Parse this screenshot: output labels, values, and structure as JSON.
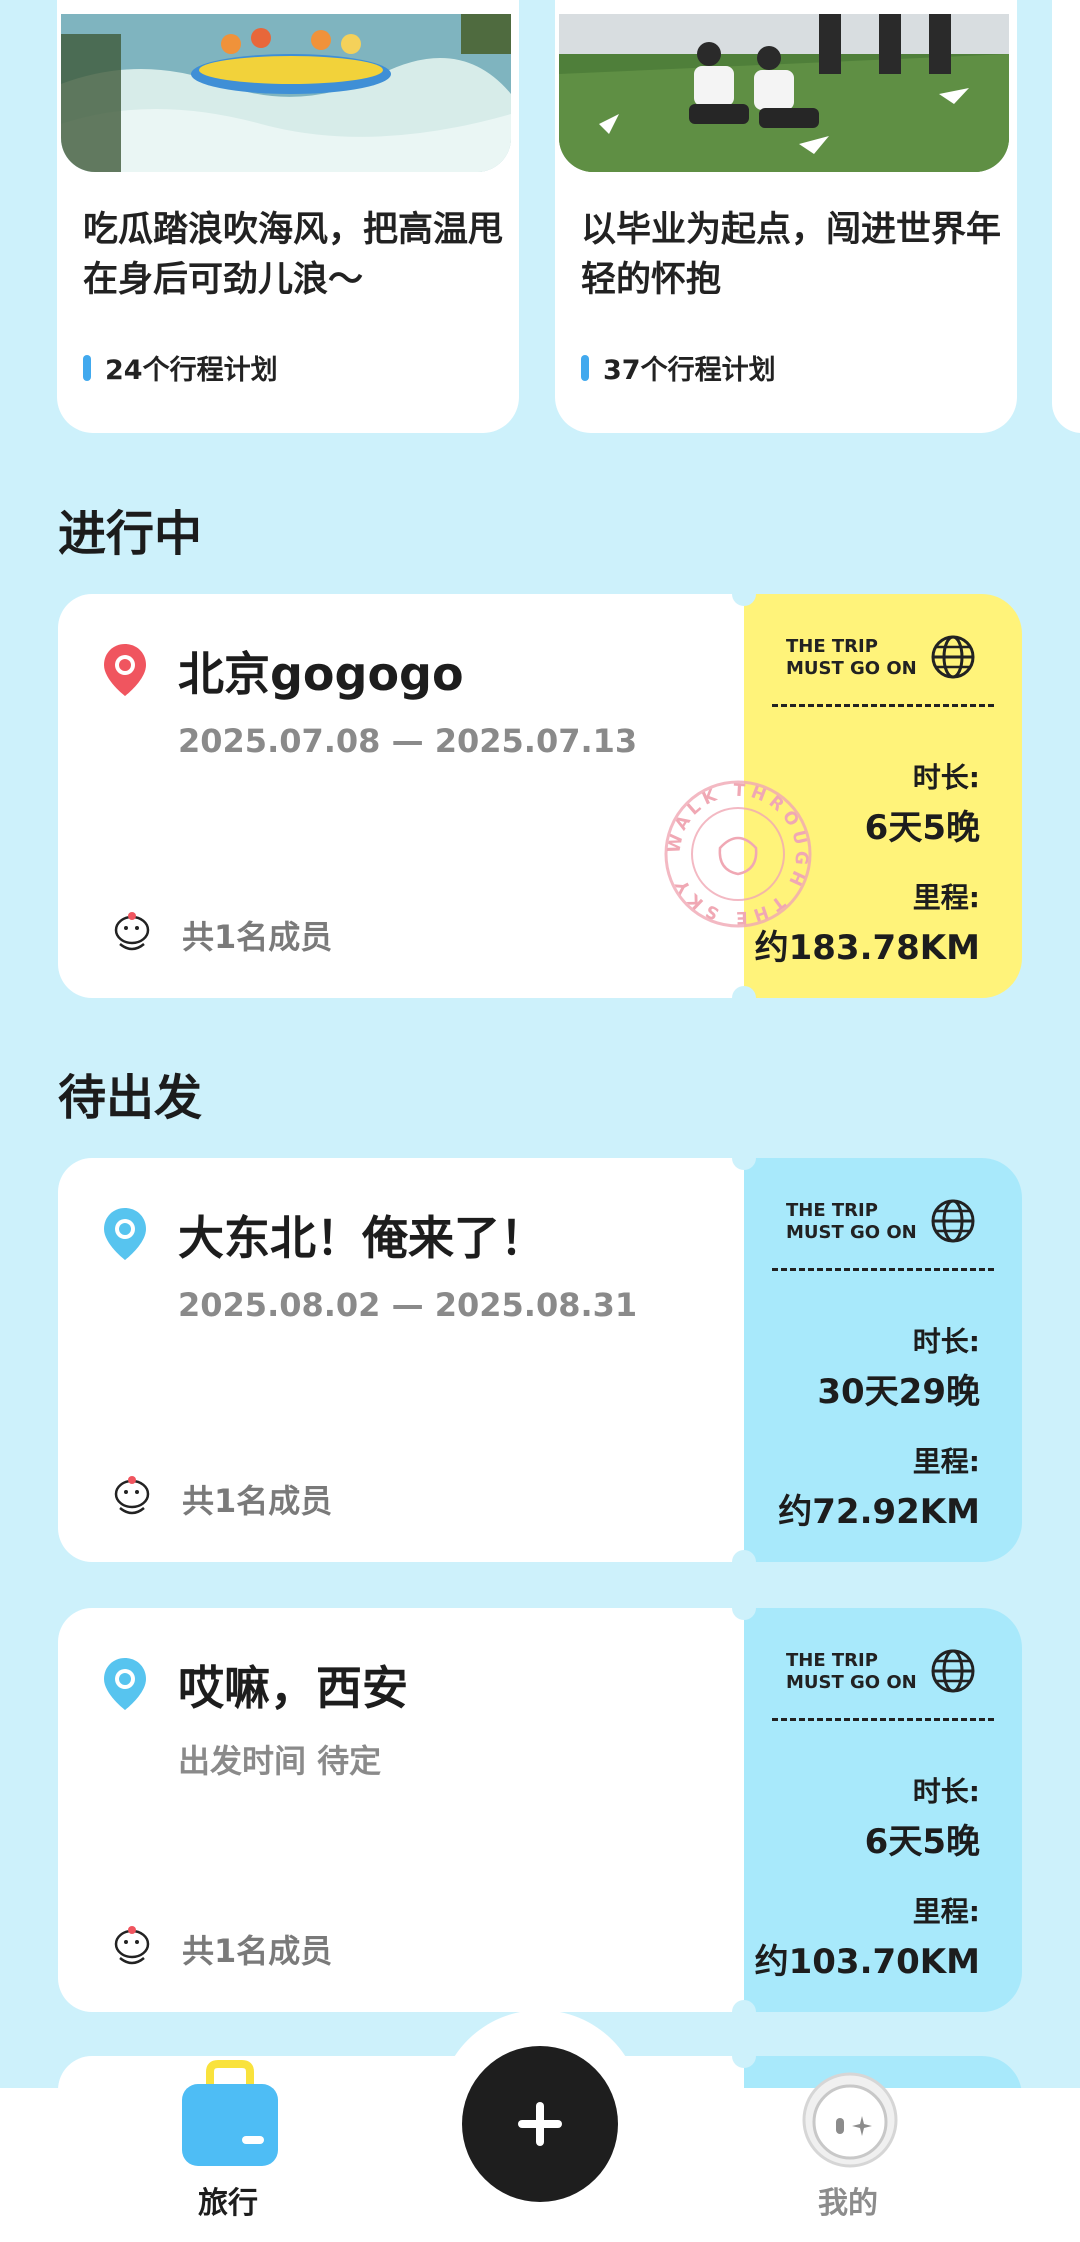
{
  "themes": [
    {
      "title": "吃瓜踏浪吹海风，把高温甩在身后可劲儿浪～",
      "count": "24个行程计划"
    },
    {
      "title": "以毕业为起点，闯进世界年轻的怀抱",
      "count": "37个行程计划"
    }
  ],
  "sections": {
    "ongoing": "进行中",
    "upcoming": "待出发"
  },
  "ticket": {
    "tag_line1": "THE TRIP",
    "tag_line2": "MUST GO ON",
    "duration_label": "时长:",
    "distance_label": "里程:"
  },
  "trips": [
    {
      "title": "北京gogogo",
      "dates": "2025.07.08 — 2025.07.13",
      "members": "共1名成员",
      "duration": "6天5晚",
      "distance": "约183.78KM",
      "accent": "#fff37a",
      "pin_color": "#f0555f"
    },
    {
      "title": "大东北！俺来了！",
      "dates": "2025.08.02 — 2025.08.31",
      "members": "共1名成员",
      "duration": "30天29晚",
      "distance": "约72.92KM",
      "accent": "#a8e9fb",
      "pin_color": "#57c4ef"
    },
    {
      "title": "哎嘛，西安",
      "dates": "出发时间 待定",
      "members": "共1名成员",
      "duration": "6天5晚",
      "distance": "约103.70KM",
      "accent": "#a8e9fb",
      "pin_color": "#57c4ef"
    }
  ],
  "stamp_text": "WALK THROUGH THE SKY",
  "nav": {
    "travel": "旅行",
    "mine": "我的",
    "travel_color": "#1d1d1d",
    "mine_color": "#8c8c8c"
  },
  "colors": {
    "background": "#cdf1fb",
    "brand_blue": "#41a9ee",
    "fab": "#1e1e1e"
  }
}
